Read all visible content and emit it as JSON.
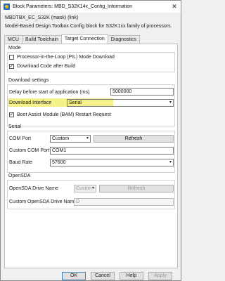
{
  "window": {
    "title": "Block Parameters: MBD_S32K14x_Config_Information",
    "close_glyph": "✕"
  },
  "mask": {
    "name": "MBDTBX_EC_S32K (mask) (link)",
    "description": "Model-Based Design Toolbox Config block for S32K1xx family of processors."
  },
  "tabs": [
    {
      "label": "MCU",
      "active": false
    },
    {
      "label": "Build Toolchain",
      "active": false
    },
    {
      "label": "Target Connection",
      "active": true
    },
    {
      "label": "Diagnostics",
      "active": false
    }
  ],
  "mode": {
    "label": "Mode",
    "pil_label": "Processor-in-the-Loop (PIL) Mode Download",
    "pil_checked": "",
    "download_label": "Download Code after Build",
    "download_checked": "✓"
  },
  "download_settings": {
    "label": "Download settings",
    "delay_label": "Delay before start of application (ms)",
    "delay_value": "5000000",
    "interface_label": "Download Interface",
    "interface_value": "Serial",
    "bam_label": "Boot Assist Module (BAM) Restart Request",
    "bam_checked": "✓",
    "highlight_color": "#f5f18a"
  },
  "serial": {
    "label": "Serial",
    "com_port_label": "COM Port",
    "com_port_value": "Custom",
    "refresh_label": "Refresh",
    "custom_com_label": "Custom COM Port",
    "custom_com_value": "COM1",
    "baud_label": "Baud Rate",
    "baud_value": "57600"
  },
  "opensda": {
    "label": "OpenSDA",
    "drive_label": "OpenSDA Drive Name",
    "drive_value": "Custon",
    "refresh_label": "Refresh",
    "custom_drive_label": "Custom OpenSDA Drive Name",
    "custom_drive_value": "D"
  },
  "footer": {
    "ok": "OK",
    "cancel": "Cancel",
    "help": "Help",
    "apply": "Apply"
  },
  "icons": {
    "dropdown": "▾"
  }
}
